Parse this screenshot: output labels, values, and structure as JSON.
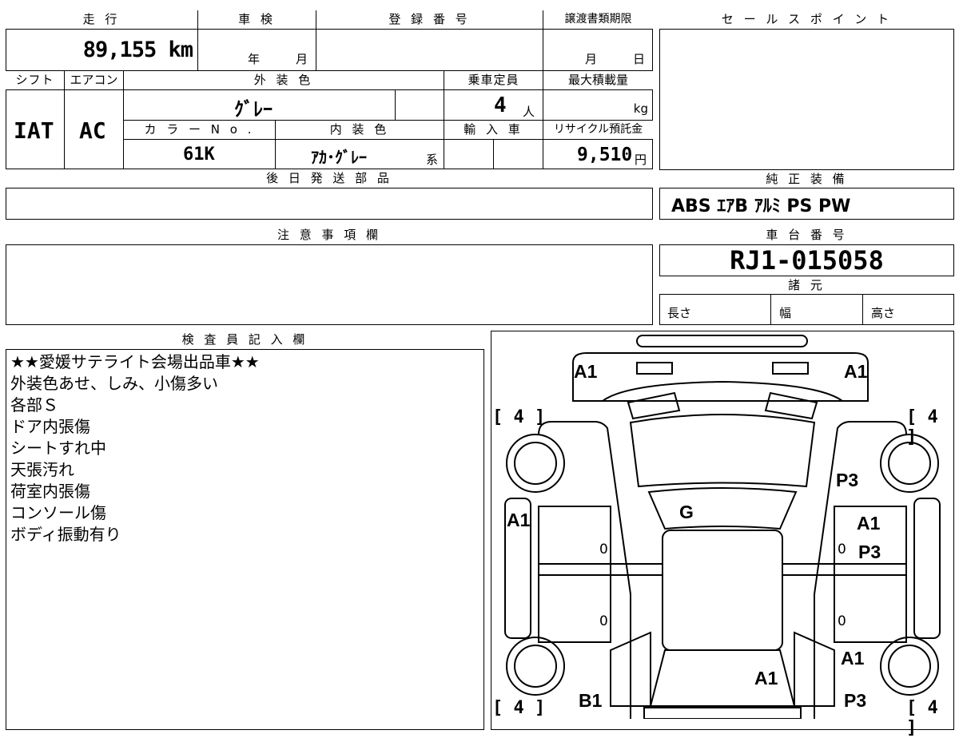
{
  "top_left": {
    "headers": {
      "mileage": "走 行",
      "inspection": "車 検",
      "registration": "登 録 番 号",
      "transfer_deadline": "譲渡書類期限",
      "shift": "シフト",
      "aircon": "エアコン",
      "exterior_color": "外 装 色",
      "capacity": "乗車定員",
      "max_load": "最大積載量",
      "color_no": "カ ラ ー N o .",
      "interior_color": "内 装 色",
      "import": "輸 入 車",
      "recycle": "リサイクル預託金",
      "parts": "後 日 発 送 部 品"
    },
    "values": {
      "mileage": "89,155 km",
      "inspection_year": "年",
      "inspection_month": "月",
      "deadline_month": "月",
      "deadline_day": "日",
      "shift": "IAT",
      "aircon": "AC",
      "exterior_color": "ｸﾞﾚｰ",
      "capacity": "4",
      "capacity_unit": "人",
      "max_load_unit": "kg",
      "color_no": "61K",
      "interior_color": "ｱｶ･ｸﾞﾚｰ",
      "interior_suffix": "系",
      "recycle": "9,510",
      "recycle_unit": "円"
    }
  },
  "sales_point": {
    "header": "セ ー ル ス ポ イ ン ト"
  },
  "equipment": {
    "header": "純 正 装 備",
    "value": "ABS ｴｱB ｱﾙﾐ PS PW"
  },
  "caution": {
    "header": "注 意 事 項 欄"
  },
  "chassis": {
    "header": "車 台 番 号",
    "value": "RJ1-015058"
  },
  "specs": {
    "header": "諸 元",
    "length": "長さ",
    "width": "幅",
    "height": "高さ"
  },
  "inspector": {
    "header": "検 査 員 記 入 欄",
    "lines": [
      "★★愛媛サテライト会場出品車★★",
      "外装色あせ、しみ、小傷多い",
      "各部Ｓ",
      "ドア内張傷",
      "シートすれ中",
      "天張汚れ",
      "荷室内張傷",
      "コンソール傷",
      "ボディ振動有り"
    ]
  },
  "diagram": {
    "labels": {
      "a1_top_left": "A1",
      "a1_top_right": "A1",
      "tire_tl": "[ 4 ]",
      "tire_tr": "[ 4 ]",
      "tire_bl": "[ 4 ]",
      "tire_br": "[ 4 ]",
      "p3_right_upper": "P3",
      "g_windshield": "G",
      "a1_left_side": "A1",
      "a1_right_side": "A1",
      "p3_right_mid": "P3",
      "a1_right_lower": "A1",
      "a1_bottom_center": "A1",
      "b1_bottom_left": "B1",
      "p3_bottom_right": "P3",
      "zero_1": "0",
      "zero_2": "0",
      "zero_3": "0",
      "zero_4": "0"
    }
  }
}
